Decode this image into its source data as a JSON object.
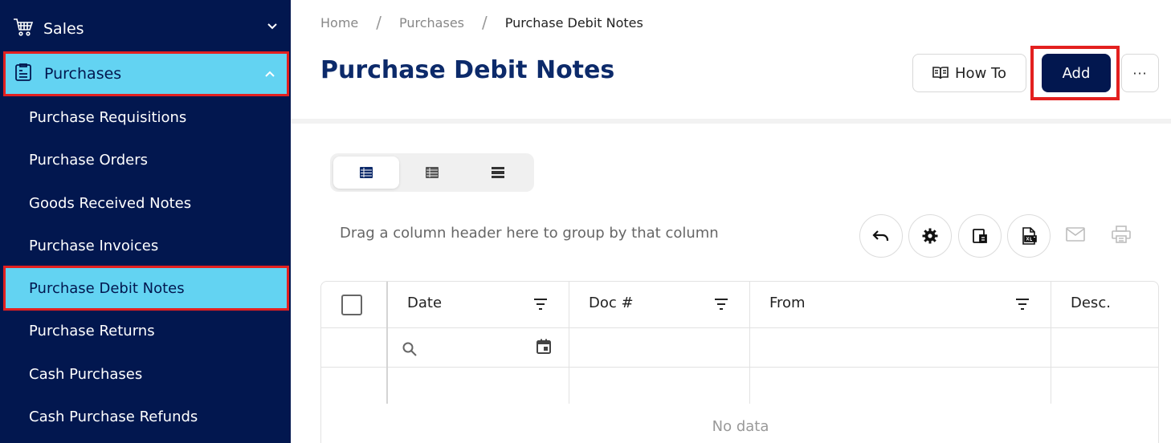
{
  "sidebar": {
    "sales": {
      "label": "Sales",
      "icon": "cart-icon"
    },
    "purchases": {
      "label": "Purchases",
      "icon": "clipboard-icon"
    },
    "items": [
      {
        "label": "Purchase Requisitions"
      },
      {
        "label": "Purchase Orders"
      },
      {
        "label": "Goods Received Notes"
      },
      {
        "label": "Purchase Invoices"
      },
      {
        "label": "Purchase Debit Notes",
        "active": true
      },
      {
        "label": "Purchase Returns"
      },
      {
        "label": "Cash Purchases"
      },
      {
        "label": "Cash Purchase Refunds"
      }
    ]
  },
  "breadcrumb": {
    "home": "Home",
    "section": "Purchases",
    "current": "Purchase Debit Notes",
    "separator": "/"
  },
  "header": {
    "title": "Purchase Debit Notes",
    "how_to_label": "How To",
    "add_label": "Add",
    "more_label": "···"
  },
  "toolbar": {
    "group_hint": "Drag a column header here to group by that column"
  },
  "grid": {
    "columns": [
      "Date",
      "Doc #",
      "From",
      "Desc."
    ],
    "empty_text": "No data"
  },
  "colors": {
    "sidebar_bg": "#02174f",
    "active_bg": "#63d3f2",
    "highlight_border": "#e3201f",
    "title": "#0c2a6a",
    "add_button": "#02174f"
  }
}
